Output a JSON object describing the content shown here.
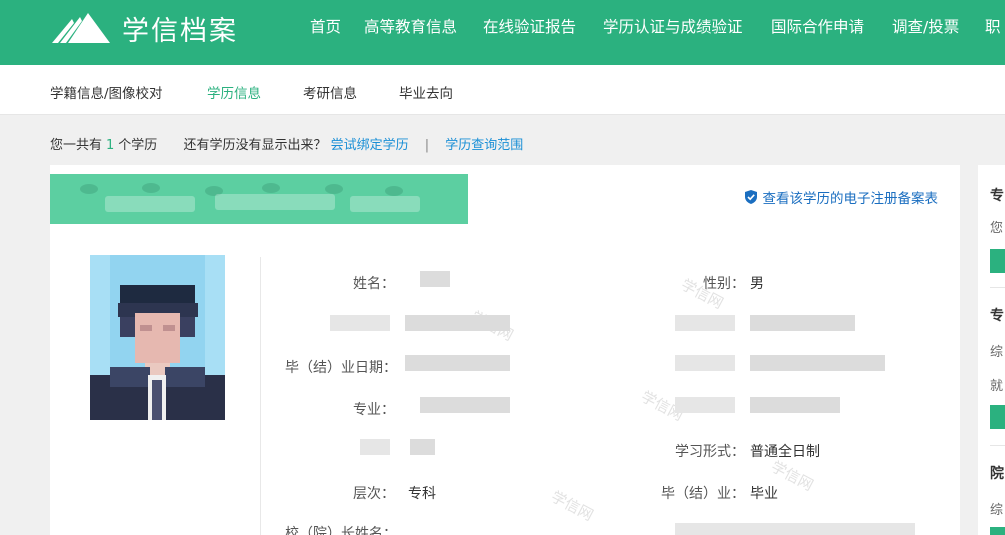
{
  "app": {
    "logo_text": "学信档案"
  },
  "nav": {
    "items": [
      {
        "label": "首页"
      },
      {
        "label": "高等教育信息"
      },
      {
        "label": "在线验证报告"
      },
      {
        "label": "学历认证与成绩验证"
      },
      {
        "label": "国际合作申请"
      },
      {
        "label": "调查/投票"
      },
      {
        "label": "职"
      }
    ]
  },
  "subnav": {
    "items": [
      {
        "label": "学籍信息/图像校对",
        "active": false
      },
      {
        "label": "学历信息",
        "active": true
      },
      {
        "label": "考研信息",
        "active": false
      },
      {
        "label": "毕业去向",
        "active": false
      }
    ]
  },
  "summary": {
    "prefix": "您一共有",
    "count": "1",
    "suffix": "个学历",
    "question": "还有学历没有显示出来？",
    "bind_link": "尝试绑定学历",
    "separator": "|",
    "scope_link": "学历查询范围"
  },
  "record": {
    "register_link": "查看该学历的电子注册备案表",
    "fields": {
      "name_label": "姓名：",
      "gender_label": "性别：",
      "gender_value": "男",
      "grad_date_label": "毕（结）业日期：",
      "major_label": "专业：",
      "study_form_label": "学习形式：",
      "study_form_value": "普通全日制",
      "level_label": "层次：",
      "level_value": "专科",
      "grad_status_label": "毕（结）业：",
      "grad_status_value": "毕业",
      "principal_label": "校（院）长姓名："
    },
    "watermark": "学信网"
  },
  "sidebar": {
    "sections": [
      {
        "title": "专",
        "texts": [
          "您"
        ]
      },
      {
        "title": "专",
        "texts": [
          "综",
          "就"
        ]
      },
      {
        "title": "院",
        "texts": [
          "综"
        ]
      }
    ]
  },
  "colors": {
    "brand": "#2bb17f",
    "link": "#1a8fd6",
    "banner": "#5ccfa1"
  }
}
